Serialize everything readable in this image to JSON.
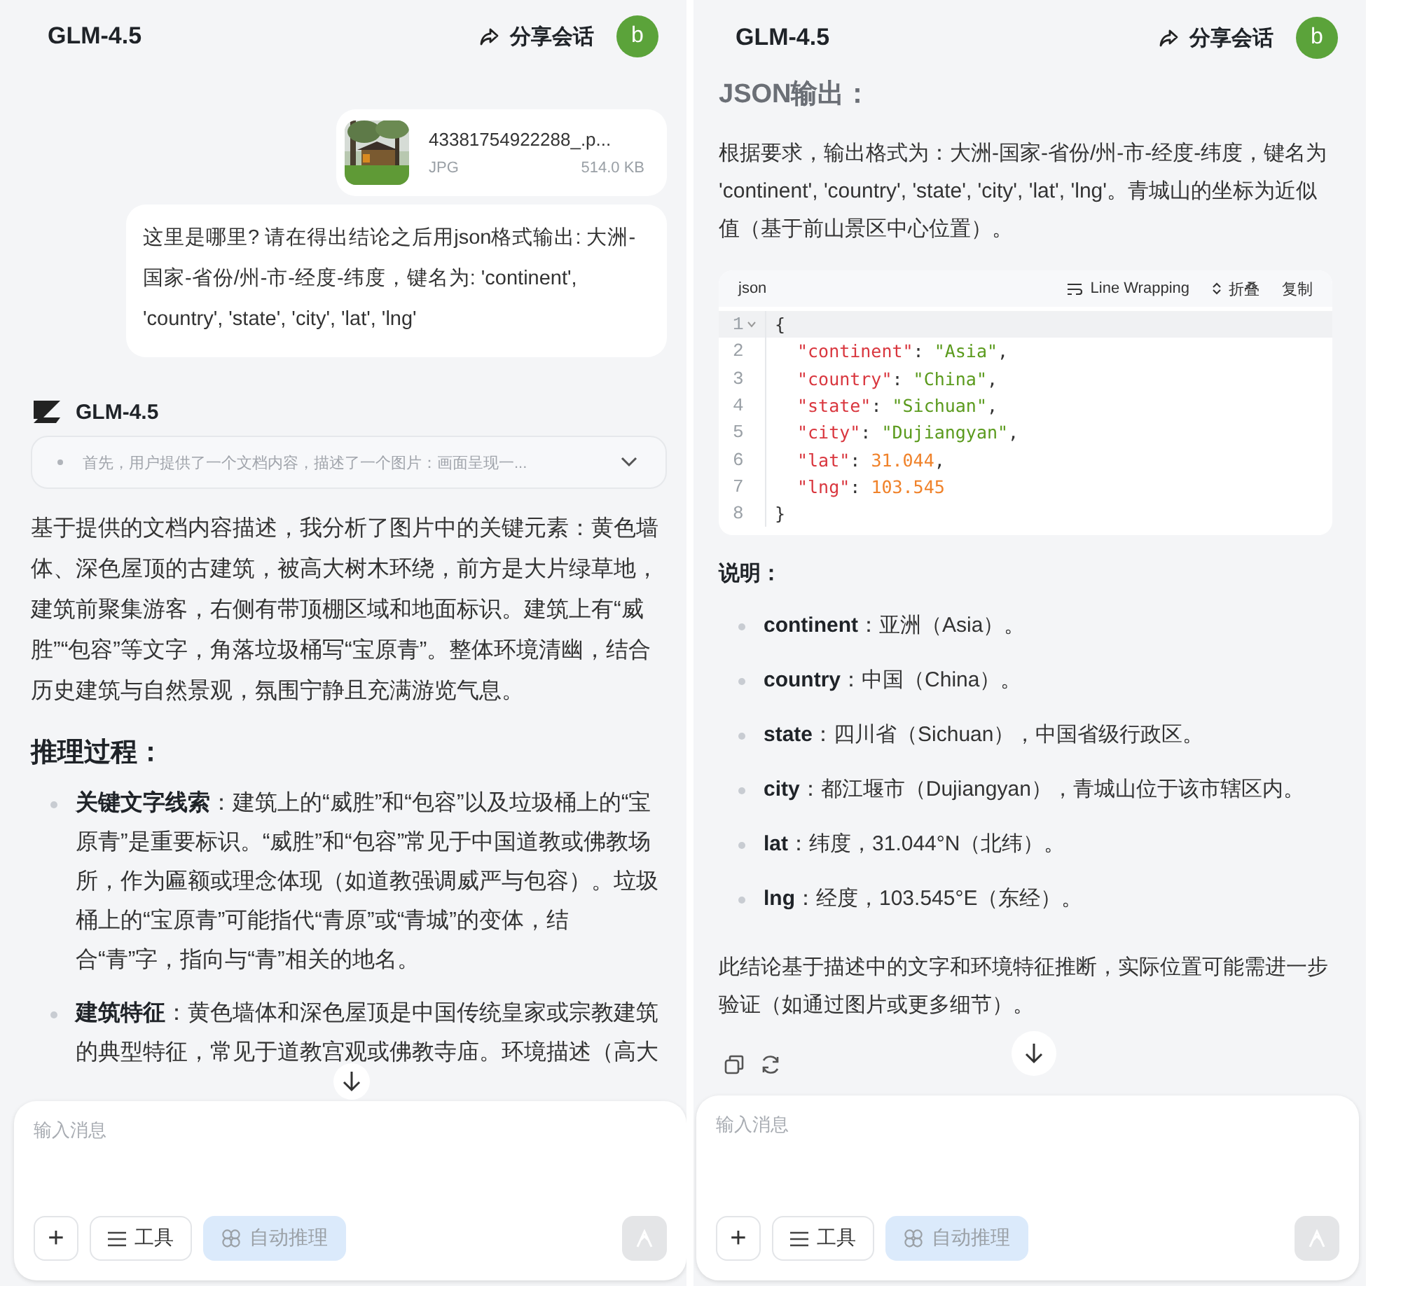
{
  "panels": [
    {
      "header": {
        "title": "GLM-4.5",
        "share": "分享会话",
        "avatar": "b"
      },
      "blocks": [
        {
          "kind": "file",
          "name": "43381754922288_.p...",
          "type": "JPG",
          "size": "514.0 KB"
        },
        {
          "kind": "user_message",
          "text": "这里是哪里? 请在得出结论之后用json格式输出: 大洲-国家-省份/州-市-经度-纬度，键名为: 'continent', 'country', 'state', 'city', 'lat', 'lng'"
        },
        {
          "kind": "assistant_header",
          "name": "GLM-4.5"
        },
        {
          "kind": "thinking",
          "text": "首先，用户提供了一个文档内容，描述了一个图片：画面呈现一...",
          "expanded": false
        },
        {
          "kind": "paragraph",
          "text": "基于提供的文档内容描述，我分析了图片中的关键元素：黄色墙体、深色屋顶的古建筑，被高大树木环绕，前方是大片绿草地，建筑前聚集游客，右侧有带顶棚区域和地面标识。建筑上有“威胜”“包容”等文字，角落垃圾桶写“宝原青”。整体环境清幽，结合历史建筑与自然景观，氛围宁静且充满游览气息。"
        },
        {
          "kind": "heading",
          "text": "推理过程："
        },
        {
          "kind": "bullets",
          "items": [
            "**关键文字线索**：建筑上的“威胜”和“包容”以及垃圾桶上的“宝原青”是重要标识。“威胜”和“包容”常见于中国道教或佛教场所，作为匾额或理念体现（如道教强调威严与包容）。垃圾桶上的“宝原青”可能指代“青原”或“青城”的变体，结合“青”字，指向与“青”相关的地名。",
            "**建筑特征**：黄色墙体和深色屋顶是中国传统皇家或宗教建筑的典型特征，常见于道教宫观或佛教寺庙。环境描述（高大"
          ]
        }
      ],
      "composer": {
        "placeholder": "输入消息",
        "buttons": [
          {
            "kind": "plus",
            "label": "+"
          },
          {
            "kind": "tools",
            "label": "工具"
          },
          {
            "kind": "auto",
            "label": "自动推理",
            "on": true
          }
        ],
        "send_disabled": true
      }
    },
    {
      "header": {
        "title": "GLM-4.5",
        "share": "分享会话",
        "avatar": "b"
      },
      "blocks": [
        {
          "kind": "heading",
          "text": "JSON输出："
        },
        {
          "kind": "paragraph",
          "text": "根据要求，输出格式为：大洲-国家-省份/州-市-经度-纬度，键名为 'continent', 'country', 'state', 'city', 'lat', 'lng'。青城山的坐标为近似值（基于前山景区中心位置）。"
        },
        {
          "kind": "code",
          "language": "json",
          "actions": [
            {
              "kind": "wrap",
              "label": "Line Wrapping"
            },
            {
              "kind": "fold",
              "label": "折叠"
            },
            {
              "kind": "copy",
              "label": "复制"
            }
          ],
          "lines": [
            {
              "number": "1",
              "highlighted": true,
              "foldable": true,
              "indent": false,
              "tokens": [
                {
                  "kind": "punct",
                  "text": "{"
                }
              ]
            },
            {
              "number": "2",
              "highlighted": false,
              "foldable": false,
              "indent": true,
              "tokens": [
                {
                  "kind": "key",
                  "text": "\"continent\""
                },
                {
                  "kind": "punct",
                  "text": ": "
                },
                {
                  "kind": "string",
                  "text": "\"Asia\""
                },
                {
                  "kind": "punct",
                  "text": ","
                }
              ]
            },
            {
              "number": "3",
              "highlighted": false,
              "foldable": false,
              "indent": true,
              "tokens": [
                {
                  "kind": "key",
                  "text": "\"country\""
                },
                {
                  "kind": "punct",
                  "text": ": "
                },
                {
                  "kind": "string",
                  "text": "\"China\""
                },
                {
                  "kind": "punct",
                  "text": ","
                }
              ]
            },
            {
              "number": "4",
              "highlighted": false,
              "foldable": false,
              "indent": true,
              "tokens": [
                {
                  "kind": "key",
                  "text": "\"state\""
                },
                {
                  "kind": "punct",
                  "text": ": "
                },
                {
                  "kind": "string",
                  "text": "\"Sichuan\""
                },
                {
                  "kind": "punct",
                  "text": ","
                }
              ]
            },
            {
              "number": "5",
              "highlighted": false,
              "foldable": false,
              "indent": true,
              "tokens": [
                {
                  "kind": "key",
                  "text": "\"city\""
                },
                {
                  "kind": "punct",
                  "text": ": "
                },
                {
                  "kind": "string",
                  "text": "\"Dujiangyan\""
                },
                {
                  "kind": "punct",
                  "text": ","
                }
              ]
            },
            {
              "number": "6",
              "highlighted": false,
              "foldable": false,
              "indent": true,
              "tokens": [
                {
                  "kind": "key",
                  "text": "\"lat\""
                },
                {
                  "kind": "punct",
                  "text": ": "
                },
                {
                  "kind": "number",
                  "text": "31.044"
                },
                {
                  "kind": "punct",
                  "text": ","
                }
              ]
            },
            {
              "number": "7",
              "highlighted": false,
              "foldable": false,
              "indent": true,
              "tokens": [
                {
                  "kind": "key",
                  "text": "\"lng\""
                },
                {
                  "kind": "punct",
                  "text": ": "
                },
                {
                  "kind": "number",
                  "text": "103.545"
                }
              ]
            },
            {
              "number": "8",
              "highlighted": false,
              "foldable": false,
              "indent": false,
              "tokens": [
                {
                  "kind": "punct",
                  "text": "}"
                }
              ]
            }
          ]
        },
        {
          "kind": "subheading",
          "text": "说明："
        },
        {
          "kind": "bullets",
          "items": [
            "**continent**：亚洲（Asia）。",
            "**country**：中国（China）。",
            "**state**：四川省（Sichuan），中国省级行政区。",
            "**city**：都江堰市（Dujiangyan），青城山位于该市辖区内。",
            "**lat**：纬度，31.044°N（北纬）。",
            "**lng**：经度，103.545°E（东经）。"
          ]
        },
        {
          "kind": "paragraph",
          "text": "此结论基于描述中的文字和环境特征推断，实际位置可能需进一步验证（如通过图片或更多细节）。"
        },
        {
          "kind": "actions"
        }
      ],
      "composer": {
        "placeholder": "输入消息",
        "buttons": [
          {
            "kind": "plus",
            "label": "+"
          },
          {
            "kind": "tools",
            "label": "工具"
          },
          {
            "kind": "auto",
            "label": "自动推理",
            "on": true
          }
        ],
        "send_disabled": true
      }
    }
  ]
}
